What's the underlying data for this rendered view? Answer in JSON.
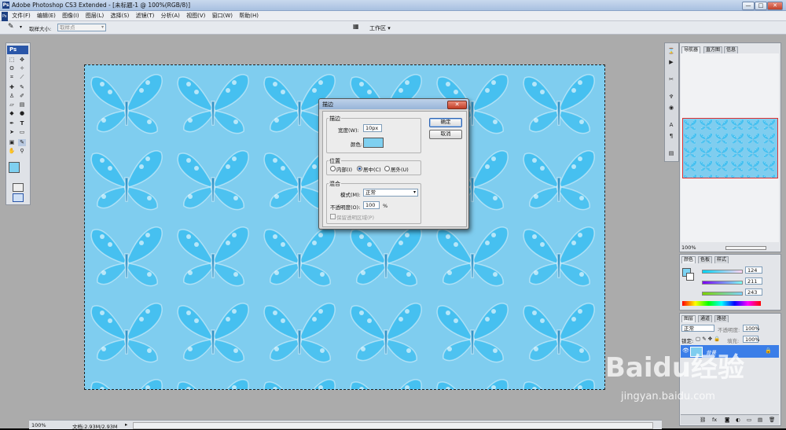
{
  "window": {
    "title": "Adobe Photoshop CS3 Extended - [未标题-1 @ 100%(RGB/8)]",
    "ps_badge": "Ps",
    "min": "—",
    "max": "□",
    "close": "✕"
  },
  "menu": [
    "文件(F)",
    "编辑(E)",
    "图像(I)",
    "图层(L)",
    "选择(S)",
    "滤镜(T)",
    "分析(A)",
    "视图(V)",
    "窗口(W)",
    "帮助(H)"
  ],
  "options": {
    "sample_size_label": "取样大小:",
    "sample_size_value": "取样点",
    "workspace_label": "工作区 ▾"
  },
  "toolbox": {
    "logo": "Ps"
  },
  "dialog": {
    "title": "描边",
    "close": "✕",
    "stroke_group": "描边",
    "width_label": "宽度(W):",
    "width_value": "10",
    "width_unit": "px",
    "color_label": "颜色:",
    "stroke_color": "#7fd0f0",
    "position_group": "位置",
    "positions": [
      "内部(I)",
      "居中(C)",
      "居外(U)"
    ],
    "selected_position": 1,
    "blend_group": "混合",
    "mode_label": "模式(M):",
    "mode_value": "正常",
    "opacity_label": "不透明度(O):",
    "opacity_value": "100",
    "opacity_unit": "%",
    "preserve_label": "保留透明区域(P)",
    "ok": "确定",
    "cancel": "取消"
  },
  "navigator": {
    "tabs": [
      "导航器",
      "直方图",
      "信息"
    ],
    "zoom": "100%"
  },
  "color_panel": {
    "tabs": [
      "颜色",
      "色板",
      "样式"
    ],
    "r": "124",
    "g": "211",
    "b": "243",
    "swatch": "#7cd3f3"
  },
  "layers_panel": {
    "tabs": [
      "图层",
      "通道",
      "路径"
    ],
    "mode": "正常",
    "opacity_label": "不透明度:",
    "opacity": "100%",
    "lock_label": "锁定:",
    "fill_label": "填充:",
    "fill": "100%",
    "layer_name": "背景"
  },
  "status": {
    "zoom": "100%",
    "doc": "文档:2.93M/2.93M"
  },
  "watermark": {
    "brand": "Baidu经验",
    "url": "jingyan.baidu.com"
  },
  "canvas": {
    "background": "#7fcdef",
    "butterfly_color": "#3cbdf0"
  }
}
